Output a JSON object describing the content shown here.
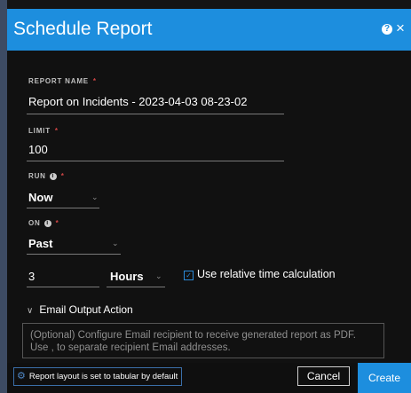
{
  "dialog": {
    "title": "Schedule Report",
    "help_icon": "help-circle-icon",
    "close_icon": "close-icon"
  },
  "form": {
    "report_name": {
      "label": "REPORT NAME",
      "value": "Report on Incidents - 2023-04-03 08-23-02"
    },
    "limit": {
      "label": "LIMIT",
      "value": "100"
    },
    "run": {
      "label": "RUN",
      "value": "Now"
    },
    "on": {
      "label": "ON",
      "value": "Past"
    },
    "relative": {
      "amount": "3",
      "unit": "Hours",
      "checkbox_label": "Use relative time calculation",
      "checked": true
    },
    "required_marker": "*",
    "info_marker": "i"
  },
  "email_section": {
    "label": "Email Output Action",
    "placeholder": "(Optional) Configure Email recipient to receive generated report as PDF. Use , to separate recipient Email addresses."
  },
  "footer": {
    "layout_note": "Report layout is set to tabular by default",
    "cancel_label": "Cancel",
    "create_label": "Create"
  },
  "colors": {
    "accent": "#1d8ede",
    "required": "#d04545",
    "background": "#111111"
  }
}
